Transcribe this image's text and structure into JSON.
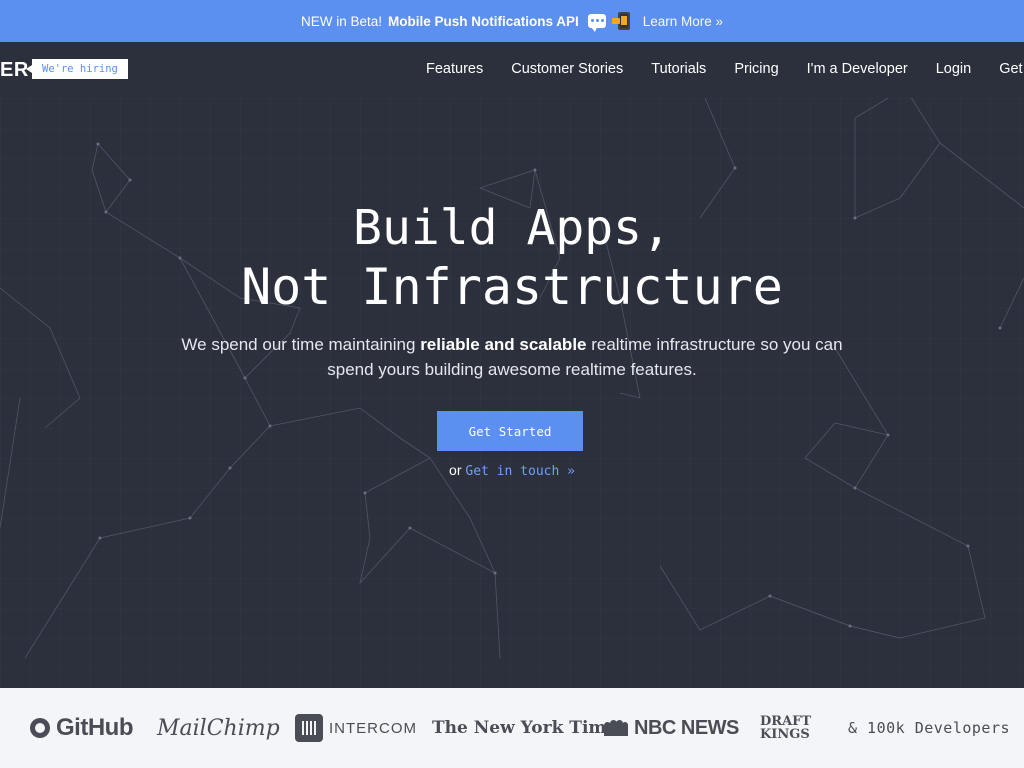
{
  "banner": {
    "prefix": "NEW in Beta!",
    "highlight": "Mobile Push Notifications API",
    "learn_more": "Learn More »"
  },
  "nav": {
    "logo": "ER",
    "hiring": "We're hiring",
    "links": [
      "Features",
      "Customer Stories",
      "Tutorials",
      "Pricing",
      "I'm a Developer",
      "Login",
      "Get"
    ]
  },
  "hero": {
    "title_line1": "Build Apps,",
    "title_line2": "Not Infrastructure",
    "sub_pre": "We spend our time maintaining",
    "sub_bold": "reliable and scalable",
    "sub_post": "realtime infrastructure so you can spend yours building awesome realtime features.",
    "cta": "Get Started",
    "or": "or",
    "contact": "Get in touch  »"
  },
  "logos": {
    "github": "GitHub",
    "mailchimp": "MailChimp",
    "intercom": "INTERCOM",
    "nyt": "The New York Times",
    "nbc": "NBC NEWS",
    "draftkings_1": "DRAFT",
    "draftkings_2": "KINGS",
    "developers": "& 100k Developers"
  },
  "colors": {
    "banner": "#5b8ff0",
    "hero_bg": "#2c2f3c",
    "accent": "#5b8ff0",
    "logos_bg": "#f3f5f9"
  }
}
